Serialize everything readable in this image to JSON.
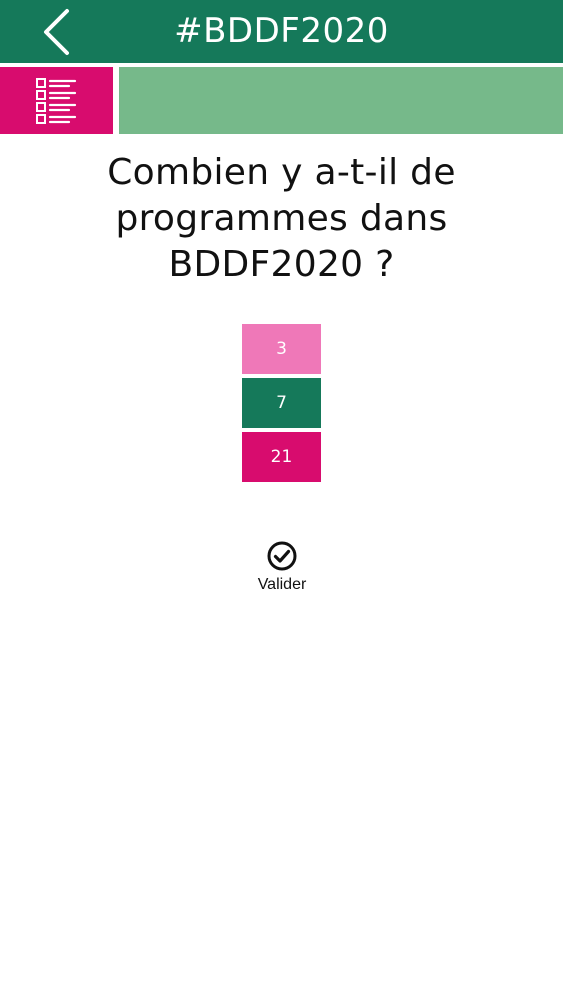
{
  "header": {
    "title": "#BDDF2020",
    "back_icon": "chevron-left-icon",
    "color": "#15795a"
  },
  "toolbar": {
    "list_icon": "checklist-icon",
    "list_color": "#d80c6e",
    "progress_color": "#76b98a"
  },
  "quiz": {
    "question": "Combien y a-t-il de programmes dans BDDF2020 ?",
    "answers": [
      {
        "label": "3",
        "color": "#ef78b8"
      },
      {
        "label": "7",
        "color": "#15795a"
      },
      {
        "label": "21",
        "color": "#d80c6e"
      }
    ],
    "validate_label": "Valider",
    "validate_icon": "check-circle-icon"
  }
}
